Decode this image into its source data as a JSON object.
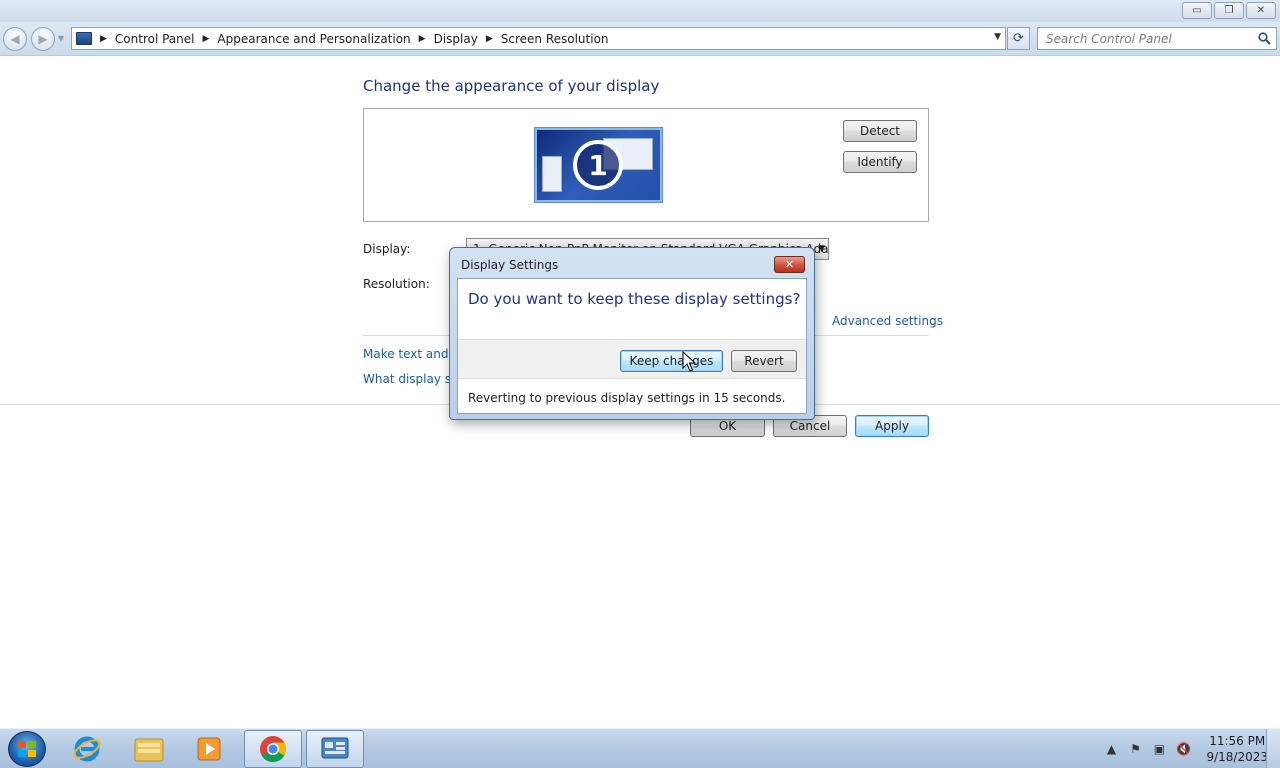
{
  "window": {
    "minimize_glyph": "▭",
    "restore_glyph": "❐",
    "close_glyph": "✕"
  },
  "nav": {
    "back_glyph": "◀",
    "forward_glyph": "▶",
    "breadcrumbs": [
      "Control Panel",
      "Appearance and Personalization",
      "Display",
      "Screen Resolution"
    ],
    "search_placeholder": "Search Control Panel",
    "refresh_glyph": "⟳"
  },
  "main": {
    "heading": "Change the appearance of your display",
    "monitor_number": "1",
    "detect_label": "Detect",
    "identify_label": "Identify",
    "display_label": "Display:",
    "display_value": "1. Generic Non-PnP Monitor on Standard VGA Graphics Adapter",
    "resolution_label": "Resolution:",
    "advanced_link": "Advanced settings",
    "link1": "Make text and ot",
    "link2": "What display set",
    "ok_label": "OK",
    "cancel_label": "Cancel",
    "apply_label": "Apply"
  },
  "dialog": {
    "title": "Display Settings",
    "question": "Do you want to keep these display settings?",
    "keep_label": "Keep changes",
    "revert_label": "Revert",
    "status": "Reverting to previous display settings in 15 seconds."
  },
  "taskbar": {
    "pinned": [
      "internet-explorer-icon",
      "file-explorer-icon",
      "media-player-icon",
      "chrome-icon",
      "control-panel-icon"
    ],
    "time": "11:56 PM",
    "date": "9/18/2023"
  },
  "colors": {
    "heading_blue": "#1e3287",
    "link_blue": "#1e5aa8",
    "accent_button_border": "#3c7fb1"
  }
}
